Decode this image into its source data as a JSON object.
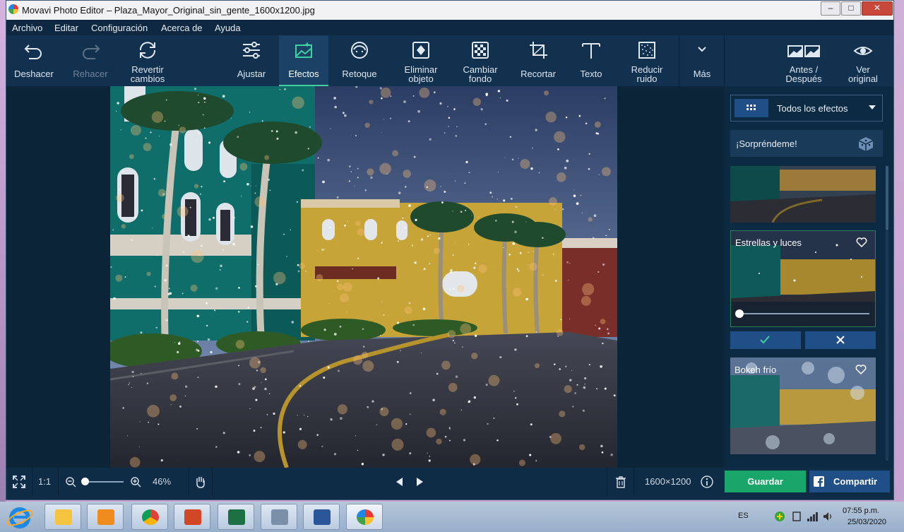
{
  "window": {
    "title": "Movavi Photo Editor – Plaza_Mayor_Original_sin_gente_1600x1200.jpg",
    "controls": [
      "–",
      "□",
      "✕"
    ]
  },
  "menu": [
    "Archivo",
    "Editar",
    "Configuración",
    "Acerca de",
    "Ayuda"
  ],
  "toolbar": {
    "undo": "Deshacer",
    "redo": "Rehacer",
    "revert_1": "Revertir",
    "revert_2": "cambios",
    "adjust": "Ajustar",
    "effects": "Efectos",
    "retouch": "Retoque",
    "remove_1": "Eliminar",
    "remove_2": "objeto",
    "bg_1": "Cambiar",
    "bg_2": "fondo",
    "crop": "Recortar",
    "text": "Texto",
    "noise_1": "Reducir",
    "noise_2": "ruido",
    "more": "Más",
    "before_1": "Antes /",
    "before_2": "Después",
    "original_1": "Ver",
    "original_2": "original"
  },
  "panel": {
    "filter_label": "Todos los efectos",
    "surprise": "¡Sorpréndeme!",
    "effects": [
      {
        "name": "Estrellas y luces",
        "intensity": 0.0
      },
      {
        "name": "Bokeh frío"
      }
    ]
  },
  "bottom": {
    "ratio": "1:1",
    "zoom": "46%",
    "zoom_level": 0.05,
    "dimensions": "1600×1200",
    "save": "Guardar",
    "share": "Compartir"
  },
  "taskbar": {
    "lang": "ES",
    "time": "07:55 p.m.",
    "date": "25/03/2020"
  },
  "colors": {
    "accent": "#3fd0a0",
    "save": "#1aa66b",
    "share": "#1f4f86",
    "toolbar": "#12314f"
  }
}
